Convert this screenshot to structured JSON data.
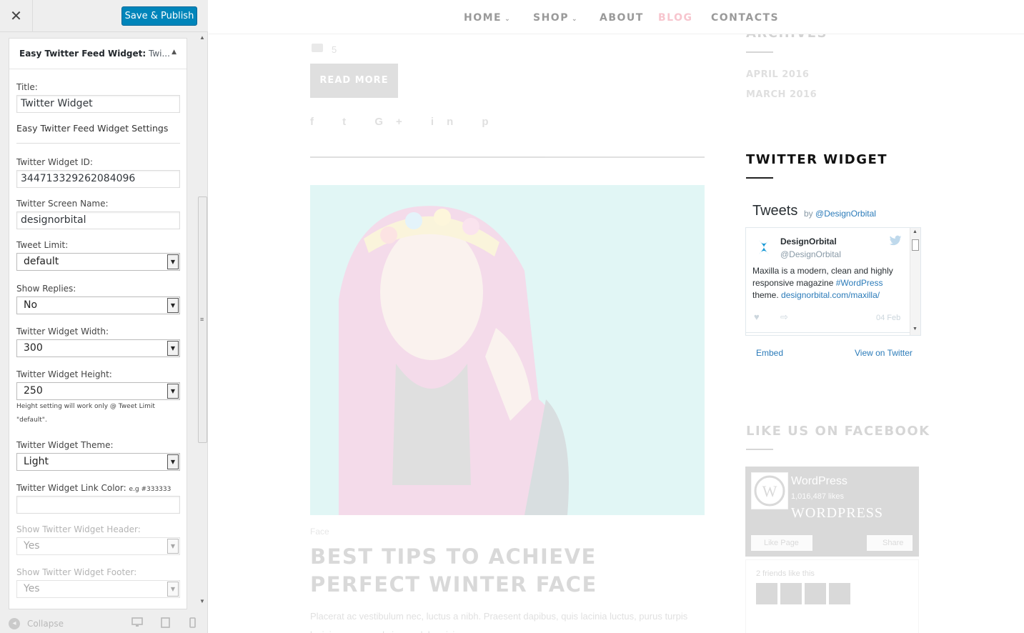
{
  "topbar": {
    "close_glyph": "✕",
    "publish_label": "Save & Publish"
  },
  "panel": {
    "header_title": "Easy Twitter Feed Widget:",
    "header_sub": " Twi...",
    "collapse_glyph": "▲",
    "title_label": "Title:",
    "title_value": "Twitter Widget",
    "settings_heading": "Easy Twitter Feed Widget Settings",
    "widget_id_label": "Twitter Widget ID:",
    "widget_id_value": "344713329262084096",
    "screen_name_label": "Twitter Screen Name:",
    "screen_name_value": "designorbital",
    "tweet_limit_label": "Tweet Limit:",
    "tweet_limit_value": "default",
    "show_replies_label": "Show Replies:",
    "show_replies_value": "No",
    "width_label": "Twitter Widget Width:",
    "width_value": "300",
    "height_label": "Twitter Widget Height:",
    "height_value": "250",
    "height_note": "Height setting will work only @ Tweet Limit \"default\".",
    "theme_label": "Twitter Widget Theme:",
    "theme_value": "Light",
    "link_color_label": "Twitter Widget Link Color:",
    "link_color_hint": "e.g #333333",
    "link_color_value": "",
    "show_header_label": "Show Twitter Widget Header:",
    "show_header_value": "Yes",
    "show_footer_label": "Show Twitter Widget Footer:",
    "show_footer_value": "Yes",
    "dropdown_glyph": "▼"
  },
  "footer": {
    "collapse_label": "Collapse",
    "collapse_glyph": "◂"
  },
  "nav": {
    "items": [
      {
        "label": "HOME"
      },
      {
        "label": "SHOP"
      },
      {
        "label": "ABOUT"
      },
      {
        "label": "BLOG"
      },
      {
        "label": "CONTACTS"
      }
    ],
    "chevron": "⌄",
    "active_color": "#f7c5ce"
  },
  "post": {
    "comment_count": "5",
    "read_more": "READ MORE",
    "share_icons": "f t G+ in p",
    "category": "Face",
    "title": "BEST TIPS TO ACHIEVE PERFECT WINTER FACE",
    "excerpt": "Placerat ac vestibulum nec, luctus a nibh. Praesent dapibus, quis lacinia luctus, purus turpis lacinia magna, vel viverra dolor nisi"
  },
  "archives": {
    "title": "ARCHIVES",
    "items": [
      "APRIL 2016",
      "MARCH 2016"
    ]
  },
  "twitter": {
    "section_title": "TWITTER WIDGET",
    "tweets_label": "Tweets",
    "by_label": "by",
    "by_handle": "@DesignOrbital",
    "author": "DesignOrbital",
    "handle": "@DesignOrbital",
    "text_1": "Maxilla is a modern, clean and highly responsive magazine ",
    "hashtag": "#WordPress",
    "text_2": " theme. ",
    "link": "designorbital.com/maxilla/",
    "date": "04 Feb",
    "embed": "Embed",
    "view_on": "View on Twitter",
    "link_color": "#2b7bb9"
  },
  "facebook": {
    "title": "LIKE US ON FACEBOOK",
    "page_name": "WordPress",
    "likes": "1,016,487 likes",
    "wordmark": "WORDPRESS",
    "like_button": "Like Page",
    "share_button": "Share",
    "friends": "2 friends like this"
  }
}
